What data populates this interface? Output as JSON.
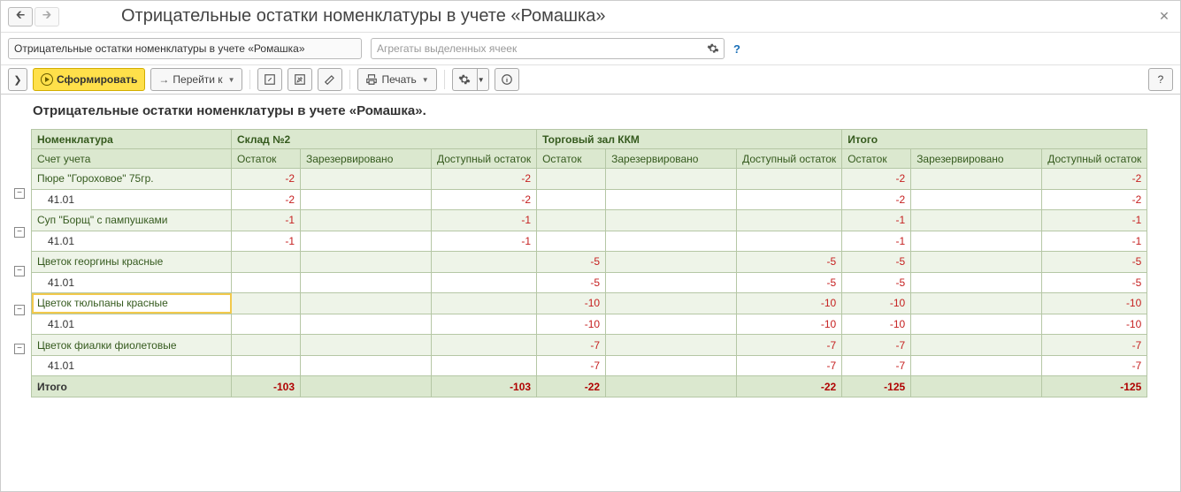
{
  "title": "Отрицательные остатки номенклатуры в учете «Ромашка»",
  "filter_name_value": "Отрицательные остатки номенклатуры в учете «Ромашка»",
  "aggr_placeholder": "Агрегаты выделенных ячеек",
  "help_marker": "?",
  "toolbar": {
    "expand": "❯",
    "generate": "Сформировать",
    "goto": "Перейти к",
    "print": "Печать"
  },
  "report": {
    "heading": "Отрицательные остатки номенклатуры в учете «Ромашка».",
    "col_nomen": "Номенклатура",
    "col_account": "Счет учета",
    "groups": [
      "Склад №2",
      "Торговый зал ККМ",
      "Итого"
    ],
    "metrics": [
      "Остаток",
      "Зарезервировано",
      "Доступный остаток"
    ],
    "rows": [
      {
        "type": "grp",
        "name": "Пюре \"Гороховое\" 75гр.",
        "w": [
          "-2",
          "",
          "-2"
        ],
        "t": [
          "",
          "",
          ""
        ],
        "i": [
          "-2",
          "",
          "-2"
        ]
      },
      {
        "type": "acc",
        "name": "41.01",
        "w": [
          "-2",
          "",
          "-2"
        ],
        "t": [
          "",
          "",
          ""
        ],
        "i": [
          "-2",
          "",
          "-2"
        ]
      },
      {
        "type": "grp",
        "name": "Суп \"Борщ\" с пампушками",
        "w": [
          "-1",
          "",
          "-1"
        ],
        "t": [
          "",
          "",
          ""
        ],
        "i": [
          "-1",
          "",
          "-1"
        ]
      },
      {
        "type": "acc",
        "name": "41.01",
        "w": [
          "-1",
          "",
          "-1"
        ],
        "t": [
          "",
          "",
          ""
        ],
        "i": [
          "-1",
          "",
          "-1"
        ]
      },
      {
        "type": "grp",
        "name": "Цветок георгины красные",
        "w": [
          "",
          "",
          ""
        ],
        "t": [
          "-5",
          "",
          "-5"
        ],
        "i": [
          "-5",
          "",
          "-5"
        ]
      },
      {
        "type": "acc",
        "name": "41.01",
        "w": [
          "",
          "",
          ""
        ],
        "t": [
          "-5",
          "",
          "-5"
        ],
        "i": [
          "-5",
          "",
          "-5"
        ]
      },
      {
        "type": "grp",
        "name": "Цветок тюльпаны красные",
        "sel": true,
        "w": [
          "",
          "",
          ""
        ],
        "t": [
          "-10",
          "",
          "-10"
        ],
        "i": [
          "-10",
          "",
          "-10"
        ]
      },
      {
        "type": "acc",
        "name": "41.01",
        "w": [
          "",
          "",
          ""
        ],
        "t": [
          "-10",
          "",
          "-10"
        ],
        "i": [
          "-10",
          "",
          "-10"
        ]
      },
      {
        "type": "grp",
        "name": "Цветок фиалки фиолетовые",
        "w": [
          "",
          "",
          ""
        ],
        "t": [
          "-7",
          "",
          "-7"
        ],
        "i": [
          "-7",
          "",
          "-7"
        ]
      },
      {
        "type": "acc",
        "name": "41.01",
        "w": [
          "",
          "",
          ""
        ],
        "t": [
          "-7",
          "",
          "-7"
        ],
        "i": [
          "-7",
          "",
          "-7"
        ]
      }
    ],
    "total_label": "Итого",
    "total": {
      "w": [
        "-103",
        "",
        "-103"
      ],
      "t": [
        "-22",
        "",
        "-22"
      ],
      "i": [
        "-125",
        "",
        "-125"
      ]
    }
  }
}
